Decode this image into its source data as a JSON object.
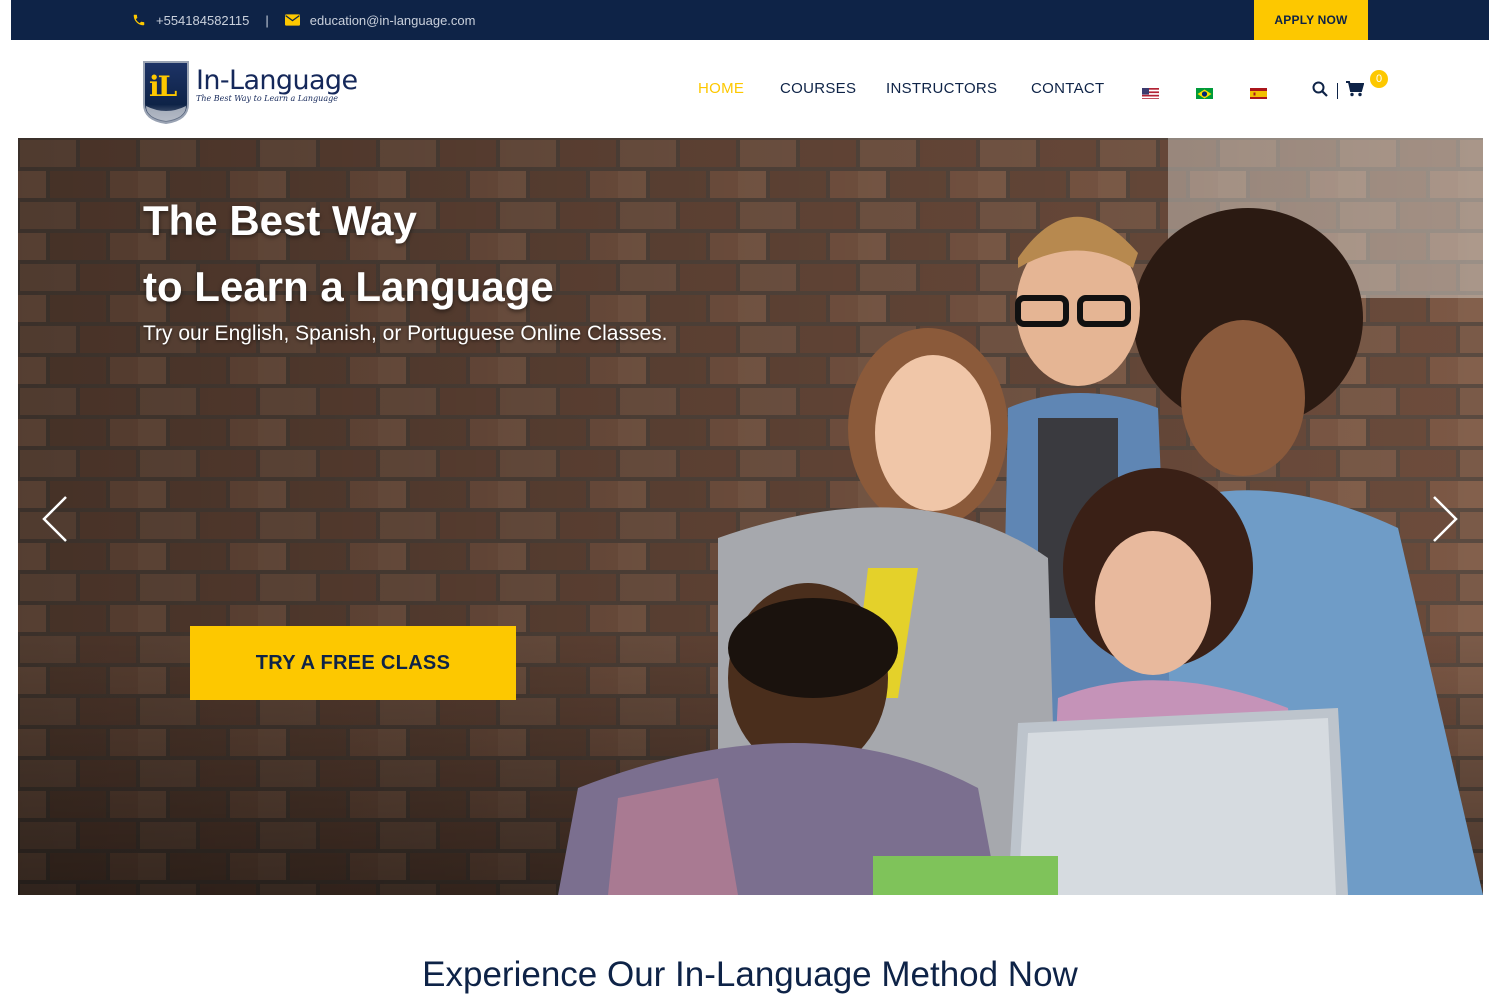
{
  "topbar": {
    "phone": "+554184582115",
    "separator": "|",
    "email": "education@in-language.com",
    "apply_label": "APPLY NOW",
    "icons": [
      "phone-icon",
      "envelope-icon"
    ]
  },
  "logo": {
    "monogram": "iL",
    "name": "In-Language",
    "tagline": "The Best Way to Learn a Language"
  },
  "nav": {
    "items": [
      {
        "label": "HOME",
        "active": true
      },
      {
        "label": "COURSES",
        "active": false
      },
      {
        "label": "INSTRUCTORS",
        "active": false
      },
      {
        "label": "CONTACT",
        "active": false
      }
    ],
    "flags": [
      "us-flag-icon",
      "brazil-flag-icon",
      "spain-flag-icon"
    ],
    "cart_count": "0"
  },
  "hero": {
    "title_line1": "The Best Way",
    "title_line2": "to Learn a Language",
    "subtitle": "Try our English, Spanish, or Portuguese Online Classes.",
    "cta_label": "TRY A FREE CLASS",
    "prev_icon": "chevron-left-icon",
    "next_icon": "chevron-right-icon"
  },
  "section": {
    "heading": "Experience Our In-Language Method Now"
  },
  "colors": {
    "navy": "#0e2347",
    "accent": "#fdc800",
    "white": "#ffffff"
  }
}
